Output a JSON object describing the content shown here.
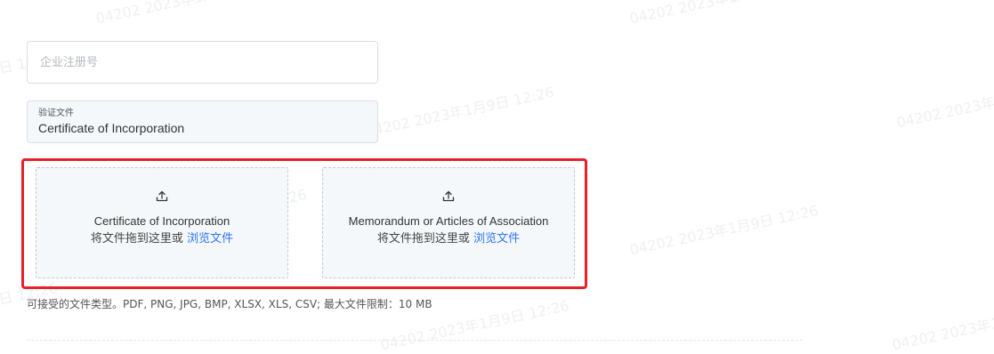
{
  "watermark": {
    "text": "04202 2023年1月9日 12:26"
  },
  "form": {
    "registration_number": {
      "placeholder": "企业注册号",
      "value": ""
    },
    "verification_document": {
      "label": "验证文件",
      "value": "Certificate of Incorporation"
    }
  },
  "uploads": [
    {
      "icon": "upload-icon",
      "title": "Certificate of Incorporation",
      "hint": "将文件拖到这里或",
      "browse_link": "浏览文件"
    },
    {
      "icon": "upload-icon",
      "title": "Memorandum or Articles of Association",
      "hint": "将文件拖到这里或",
      "browse_link": "浏览文件"
    }
  ],
  "accepted_types_text": "可接受的文件类型。PDF, PNG, JPG, BMP, XLSX, XLS, CSV; 最大文件限制：10 MB",
  "colors": {
    "highlight_border": "#e8202a",
    "link": "#2f74f5",
    "dropzone_bg": "#f5f8fb"
  }
}
